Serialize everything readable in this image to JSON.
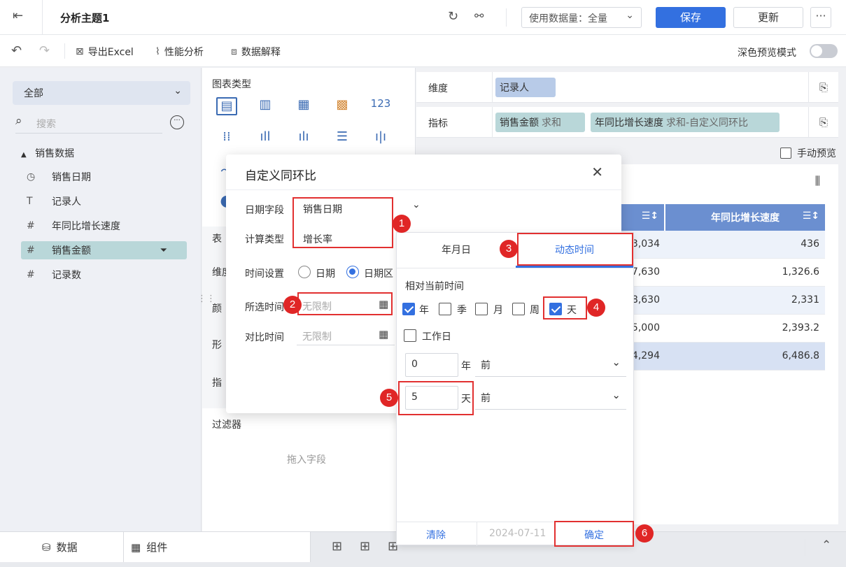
{
  "header": {
    "title": "分析主题1",
    "data_amount": "使用数据量：全量",
    "save_label": "保存",
    "update_label": "更新",
    "more_label": "···"
  },
  "toolbar": {
    "export_label": "导出Excel",
    "performance_label": "性能分析",
    "explain_label": "数据解释",
    "dark_mode_label": "深色预览模式"
  },
  "left_panel": {
    "scope": "全部",
    "search_placeholder": "搜索",
    "group": "销售数据",
    "fields": [
      {
        "icon": "clock-icon",
        "glyph": "◷",
        "label": "销售日期"
      },
      {
        "icon": "text-icon",
        "glyph": "T",
        "label": "记录人"
      },
      {
        "icon": "number-icon",
        "glyph": "#",
        "label": "年同比增长速度"
      },
      {
        "icon": "number-icon",
        "glyph": "#",
        "label": "销售金额"
      },
      {
        "icon": "count-icon",
        "glyph": "#",
        "label": "记录数"
      }
    ]
  },
  "middle_panel": {
    "chart_type_title": "图表类型",
    "table_label": "表",
    "dim_label": "维度",
    "color_label": "颜",
    "shape_label": "形",
    "metric_label": "指",
    "filter_title": "过滤器",
    "drag_hint": "拖入字段"
  },
  "right_panel": {
    "dimension_label": "维度",
    "metric_label": "指标",
    "dim_pill": "记录人",
    "metric_pill_1": "销售金额",
    "metric_pill_1_sub": "求和",
    "metric_pill_2": "年同比增长速度",
    "metric_pill_2_sub": "求和-自定义同环比",
    "manual_preview": "手动预览",
    "table": {
      "headers": [
        "额",
        "年同比增长速度"
      ],
      "rows": [
        [
          "3,034",
          "436"
        ],
        [
          "7,630",
          "1,326.6"
        ],
        [
          "8,630",
          "2,331"
        ],
        [
          "5,000",
          "2,393.2"
        ],
        [
          "4,294",
          "6,486.8"
        ]
      ]
    }
  },
  "dialog": {
    "title": "自定义同环比",
    "date_field_label": "日期字段",
    "date_field_value": "销售日期",
    "calc_type_label": "计算类型",
    "calc_type_value": "增长率",
    "time_setting_label": "时间设置",
    "opt_date": "日期",
    "opt_range": "日期区",
    "selected_time_label": "所选时间",
    "selected_time_placeholder": "无限制",
    "compare_time_label": "对比时间",
    "compare_time_placeholder": "无限制"
  },
  "popup": {
    "tab_ymd": "年月日",
    "tab_dynamic": "动态时间",
    "relative_label": "相对当前时间",
    "checks": [
      {
        "label": "年",
        "checked": true
      },
      {
        "label": "季",
        "checked": false
      },
      {
        "label": "月",
        "checked": false
      },
      {
        "label": "周",
        "checked": false
      },
      {
        "label": "天",
        "checked": true
      }
    ],
    "workday_label": "工作日",
    "year_value": "0",
    "year_unit": "年",
    "year_dir": "前",
    "day_value": "5",
    "day_unit": "天",
    "day_dir": "前",
    "clear_label": "清除",
    "date_display": "2024-07-11",
    "ok_label": "确定"
  },
  "bottom": {
    "data_tab": "数据",
    "component_tab": "组件"
  },
  "annotations": [
    "1",
    "2",
    "3",
    "4",
    "5",
    "6"
  ],
  "colors": {
    "accent": "#3370e0",
    "annotation_red": "#e02626",
    "header_blue": "#6b8fd0",
    "teal_pill": "#b9d7d9"
  }
}
